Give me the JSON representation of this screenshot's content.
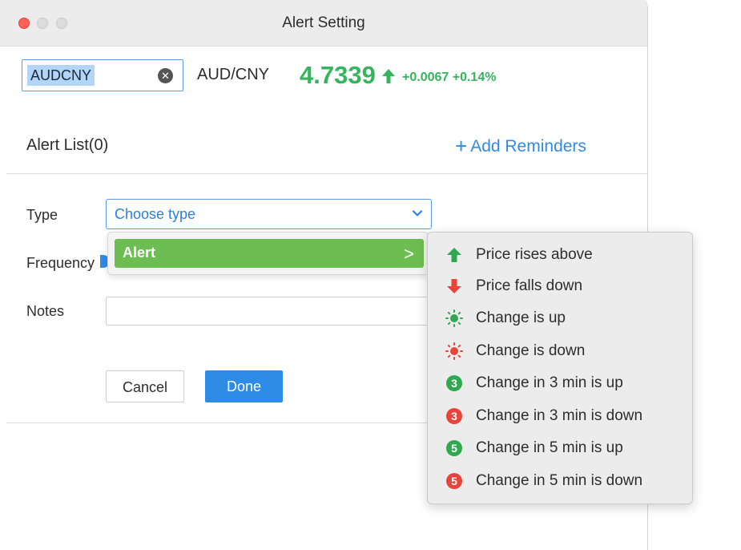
{
  "window": {
    "title": "Alert Setting"
  },
  "quote": {
    "symbol_input": "AUDCNY",
    "pair": "AUD/CNY",
    "price": "4.7339",
    "change": "+0.0067 +0.14%",
    "color_up": "#35b55c"
  },
  "alert_list": {
    "title": "Alert List(0)",
    "add_plus": "+",
    "add_label": "Add Reminders"
  },
  "form": {
    "type_label": "Type",
    "type_placeholder": "Choose type",
    "frequency_label": "Frequency",
    "notes_label": "Notes",
    "notes_value": "",
    "cancel_label": "Cancel",
    "done_label": "Done"
  },
  "type_menu": {
    "category": "Alert",
    "chevron": ">",
    "items": [
      {
        "label": "Price rises above",
        "icon": "arrow-up-icon",
        "color": "#2fa84f"
      },
      {
        "label": "Price falls down",
        "icon": "arrow-down-icon",
        "color": "#e8443a"
      },
      {
        "label": "Change is up",
        "icon": "sun-up-icon",
        "color": "#2fa84f"
      },
      {
        "label": "Change is down",
        "icon": "sun-down-icon",
        "color": "#e8443a"
      },
      {
        "label": "Change in 3 min is up",
        "icon": "three-min-up-icon",
        "badge": "3",
        "color": "#2fa84f"
      },
      {
        "label": "Change in 3 min is down",
        "icon": "three-min-down-icon",
        "badge": "3",
        "color": "#e8443a"
      },
      {
        "label": "Change in 5 min is up",
        "icon": "five-min-up-icon",
        "badge": "5",
        "color": "#2fa84f"
      },
      {
        "label": "Change in 5 min is down",
        "icon": "five-min-down-icon",
        "badge": "5",
        "color": "#e8443a"
      }
    ]
  },
  "colors": {
    "accent": "#2f8ce6",
    "menu_green": "#6dbe52"
  }
}
